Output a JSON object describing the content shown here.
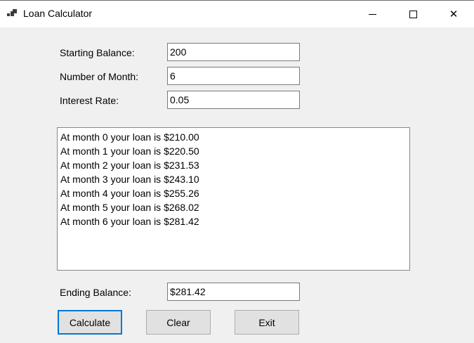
{
  "window": {
    "title": "Loan Calculator",
    "icons": {
      "app": "app-icon",
      "minimize": "minimize-icon",
      "maximize": "maximize-icon",
      "close": "close-icon"
    },
    "close_glyph": "✕"
  },
  "form": {
    "starting_balance": {
      "label": "Starting Balance:",
      "value": "200"
    },
    "months": {
      "label": "Number of Month:",
      "value": "6"
    },
    "interest_rate": {
      "label": "Interest Rate:",
      "value": "0.05"
    },
    "ending_balance": {
      "label": "Ending Balance:",
      "value": "$281.42"
    }
  },
  "results": [
    "At month 0 your loan is $210.00",
    "At month 1 your loan is $220.50",
    "At month 2 your loan is $231.53",
    "At month 3 your loan is $243.10",
    "At month 4 your loan is $255.26",
    "At month 5 your loan is $268.02",
    "At month 6 your loan is $281.42"
  ],
  "buttons": {
    "calculate": "Calculate",
    "clear": "Clear",
    "exit": "Exit"
  },
  "colors": {
    "focus_border": "#0078d7",
    "window_bg": "#f0f0f0",
    "titlebar_bg": "#ffffff"
  }
}
